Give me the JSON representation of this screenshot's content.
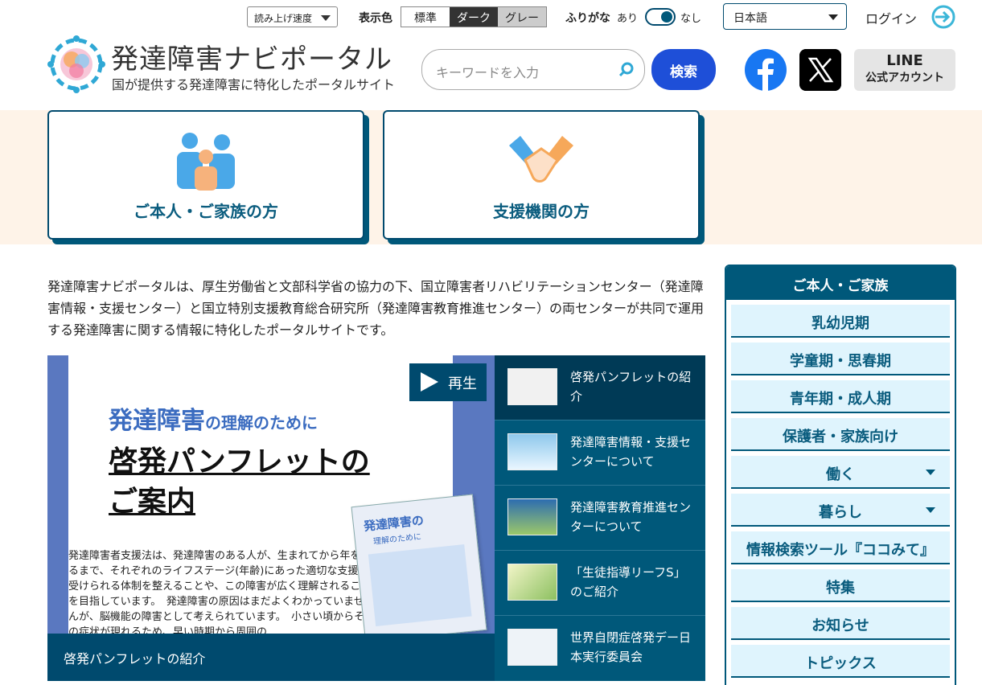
{
  "utility": {
    "speed_label": "読み上げ速度",
    "color_label": "表示色",
    "color_options": [
      "標準",
      "ダーク",
      "グレー"
    ],
    "furigana_label": "ふりがな",
    "furigana_on": "あり",
    "furigana_off": "なし",
    "language": "日本語",
    "login": "ログイン"
  },
  "header": {
    "title": "発達障害ナビポータル",
    "subtitle": "国が提供する発達障害に特化したポータルサイト",
    "search_placeholder": "キーワードを入力",
    "search_button": "検索",
    "line_line1": "LINE",
    "line_line2": "公式アカウント"
  },
  "entry_cards": [
    {
      "label": "ご本人・ご家族の方"
    },
    {
      "label": "支援機関の方"
    }
  ],
  "intro": "発達障害ナビポータルは、厚生労働省と文部科学省の協力の下、国立障害者リハビリテーションセンター（発達障害情報・支援センター）と国立特別支援教育総合研究所（発達障害教育推進センター）の両センターが共同で運用する発達障害に関する情報に特化したポータルサイトです。",
  "slider": {
    "play_label": "再生",
    "slide_heading_main": "発達障害",
    "slide_heading_sub": "の理解のために",
    "slide_title_line1": "啓発パンフレットの",
    "slide_title_line2": "ご案内",
    "slide_body": "発達障害者支援法は、発達障害のある人が、生まれてから年をとるまで、それぞれのライフステージ(年齢)にあった適切な支援を受けられる体制を整えることや、この障害が広く理解されることを目指しています。　発達障害の原因はまだよくわかっていませんが、脳機能の障害として考えられています。　小さい頃からその症状が現れるため、早い時期から周囲の",
    "booklet_title": "発達障害の",
    "booklet_sub": "理解のために",
    "caption": "啓発パンフレットの紹介"
  },
  "thumbs": [
    {
      "label": "啓発パンフレットの紹介"
    },
    {
      "label": "発達障害情報・支援センターについて"
    },
    {
      "label": "発達障害教育推進センターについて"
    },
    {
      "label": "「生徒指導リーフS」のご紹介"
    },
    {
      "label": "世界自閉症啓発デー日本実行委員会"
    }
  ],
  "side_nav": {
    "heading": "ご本人・ご家族",
    "items": [
      {
        "label": "乳幼児期"
      },
      {
        "label": "学童期・思春期"
      },
      {
        "label": "青年期・成人期"
      },
      {
        "label": "保護者・家族向け"
      },
      {
        "label": "働く"
      },
      {
        "label": "暮らし"
      },
      {
        "label": "情報検索ツール『ココみて』"
      },
      {
        "label": "特集"
      },
      {
        "label": "お知らせ"
      },
      {
        "label": "トピックス"
      }
    ]
  },
  "colors": {
    "primary": "#00587a",
    "search_button": "#1e4fd8",
    "band": "#fef3e8",
    "side_item": "#dff4fd"
  }
}
